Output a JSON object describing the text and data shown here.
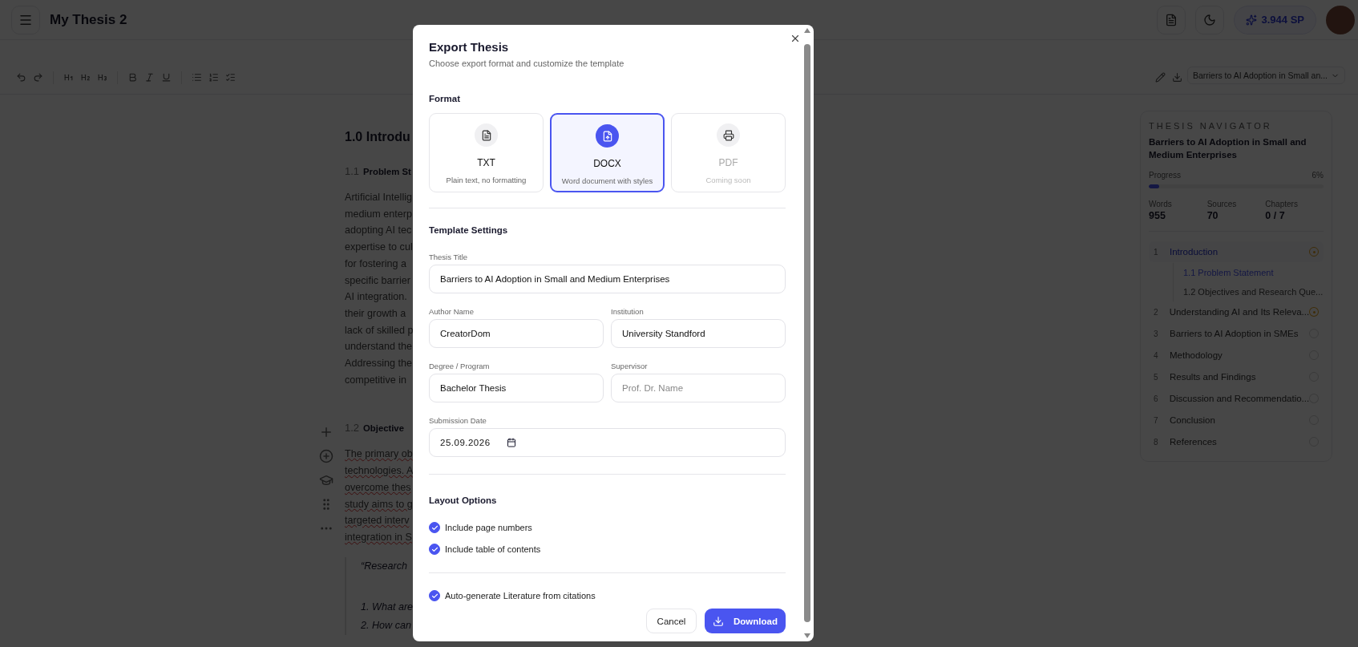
{
  "app_bar": {
    "title": "My Thesis 2",
    "credits": "3.944 SP"
  },
  "toolbar": {
    "document_select": "Barriers to AI Adoption in Small an..."
  },
  "document": {
    "heading": "1.0 Introdu",
    "sections": [
      {
        "number": "1.1",
        "title": "Problem St",
        "lines": [
          "Artificial Intellig",
          "medium enterp",
          "adopting AI tec",
          "expertise to cul",
          "for fostering a",
          "specific barrier",
          "AI integration.",
          "their growth a",
          "lack of skilled p",
          "understand the",
          "Addressing the",
          "competitive in"
        ],
        "spellcheck": false
      },
      {
        "number": "1.2",
        "title": "Objective",
        "lines": [
          "The primary ob",
          "technologies. A",
          "overcome thes",
          "study aims to g",
          "targeted interv",
          "integration in S"
        ],
        "spellcheck": true
      }
    ],
    "quote": [
      "“Research",
      "1. What are",
      "2. How can"
    ]
  },
  "navigator": {
    "heading": "THESIS NAVIGATOR",
    "title": "Barriers to AI Adoption in Small and Medium Enterprises",
    "progress_label": "Progress",
    "progress_value": "6%",
    "level": 0.06,
    "stats": [
      {
        "label": "Words",
        "value": "955"
      },
      {
        "label": "Sources",
        "value": "70"
      },
      {
        "label": "Chapters",
        "value": "0 / 7"
      }
    ],
    "chapters": [
      {
        "number": "1",
        "title": "Introduction",
        "selected": true,
        "in_progress": true,
        "children": [
          {
            "title": "1.1 Problem Statement",
            "selected": true
          },
          {
            "title": "1.2 Objectives and Research Que...",
            "selected": false
          }
        ]
      },
      {
        "number": "2",
        "title": "Understanding AI and Its Releva...",
        "selected": false,
        "in_progress": true
      },
      {
        "number": "3",
        "title": "Barriers to AI Adoption in SMEs",
        "selected": false,
        "in_progress": false
      },
      {
        "number": "4",
        "title": "Methodology",
        "selected": false,
        "in_progress": false
      },
      {
        "number": "5",
        "title": "Results and Findings",
        "selected": false,
        "in_progress": false
      },
      {
        "number": "6",
        "title": "Discussion and Recommendatio...",
        "selected": false,
        "in_progress": false
      },
      {
        "number": "7",
        "title": "Conclusion",
        "selected": false,
        "in_progress": false
      },
      {
        "number": "8",
        "title": "References",
        "selected": false,
        "in_progress": false
      }
    ]
  },
  "dialog": {
    "title": "Export Thesis",
    "subtitle": "Choose export format and customize the template",
    "format_heading": "Format",
    "formats": [
      {
        "kind": "text",
        "label": "TXT",
        "description": "Plain text, no formatting",
        "selected": false,
        "disabled": false
      },
      {
        "kind": "document",
        "label": "DOCX",
        "description": "Word document with styles",
        "selected": true,
        "disabled": false
      },
      {
        "kind": "print",
        "label": "PDF",
        "description": "Coming soon",
        "selected": false,
        "disabled": true
      }
    ],
    "template_heading": "Template Settings",
    "fields": [
      {
        "label": "Thesis Title",
        "value": "Barriers to AI Adoption in Small and Medium Enterprises",
        "kind": "text",
        "wide": true
      },
      {
        "label": "Author Name",
        "value": "CreatorDom",
        "kind": "text",
        "wide": false
      },
      {
        "label": "Institution",
        "value": "University Standford",
        "kind": "text",
        "wide": false
      },
      {
        "label": "Degree / Program",
        "value": "Bachelor Thesis",
        "kind": "text",
        "wide": false
      },
      {
        "label": "Supervisor",
        "placeholder": "Prof. Dr. Name",
        "kind": "text",
        "wide": false
      },
      {
        "label": "Submission Date",
        "value": "25.09.2026",
        "kind": "date",
        "wide": true
      }
    ],
    "layout_heading": "Layout Options",
    "layout_options": [
      {
        "label": "Include page numbers",
        "checked": true
      },
      {
        "label": "Include table of contents",
        "checked": true
      }
    ],
    "extra_options": [
      {
        "label": "Auto-generate Literature from citations",
        "checked": true
      }
    ],
    "buttons": {
      "cancel": "Cancel",
      "download": "Download"
    }
  }
}
